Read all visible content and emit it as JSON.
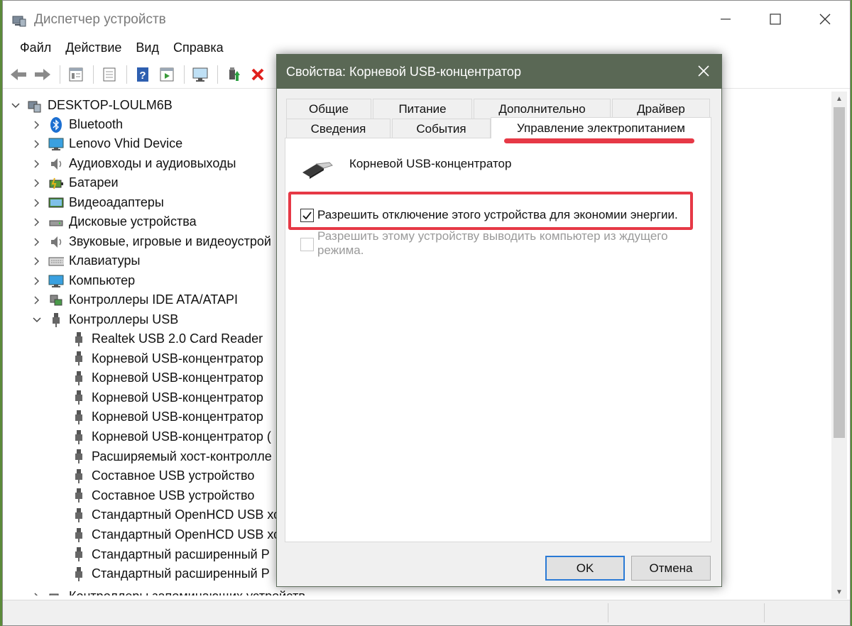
{
  "window": {
    "title": "Диспетчер устройств"
  },
  "menu": [
    "Файл",
    "Действие",
    "Вид",
    "Справка"
  ],
  "toolbar": {
    "buttons": [
      "back-icon",
      "forward-icon",
      "properties-icon",
      "show-hidden-icon",
      "help-icon",
      "run-icon",
      "monitor-icon",
      "update-driver-icon",
      "delete-icon"
    ]
  },
  "tree": {
    "root": "DESKTOP-LOULM6B",
    "items": [
      {
        "label": "Bluetooth",
        "icon": "bluetooth-icon"
      },
      {
        "label": "Lenovo Vhid Device",
        "icon": "monitor-icon"
      },
      {
        "label": "Аудиовходы и аудиовыходы",
        "icon": "speaker-icon"
      },
      {
        "label": "Батареи",
        "icon": "battery-icon"
      },
      {
        "label": "Видеоадаптеры",
        "icon": "display-adapter-icon"
      },
      {
        "label": "Дисковые устройства",
        "icon": "disk-icon"
      },
      {
        "label": "Звуковые, игровые и видеоустрой",
        "icon": "speaker-icon"
      },
      {
        "label": "Клавиатуры",
        "icon": "keyboard-icon"
      },
      {
        "label": "Компьютер",
        "icon": "computer-icon"
      },
      {
        "label": "Контроллеры IDE ATA/ATAPI",
        "icon": "ide-icon"
      },
      {
        "label": "Контроллеры USB",
        "icon": "usb-icon"
      }
    ],
    "usb_children": [
      "Realtek USB 2.0 Card Reader",
      "Корневой USB-концентратор",
      "Корневой USB-концентратор",
      "Корневой USB-концентратор",
      "Корневой USB-концентратор",
      "Корневой USB-концентратор (",
      "Расширяемый хост-контролле",
      "Составное USB устройство",
      "Составное USB устройство",
      "Стандартный OpenHCD USB хо",
      "Стандартный OpenHCD USB хо",
      "Стандартный расширенный Р",
      "Стандартный расширенный Р"
    ],
    "last_item": "Контроллеры запоминающих устройств"
  },
  "dialog": {
    "title": "Свойства: Корневой USB-концентратор",
    "tabs_row1": [
      "Общие",
      "Питание",
      "Дополнительно",
      "Драйвер"
    ],
    "tabs_row2": [
      "Сведения",
      "События",
      "Управление электропитанием"
    ],
    "active_tab": "Управление электропитанием",
    "device_name": "Корневой USB-концентратор",
    "option1": {
      "label": "Разрешить отключение этого устройства для экономии энергии.",
      "checked": true
    },
    "option2": {
      "label": "Разрешить этому устройству выводить компьютер из ждущего режима.",
      "checked": false,
      "enabled": false
    },
    "ok_label": "OK",
    "cancel_label": "Отмена"
  },
  "colors": {
    "highlight_red": "#e63946",
    "dialog_title_bg": "#5a6855",
    "ok_border": "#2a7ad5"
  }
}
